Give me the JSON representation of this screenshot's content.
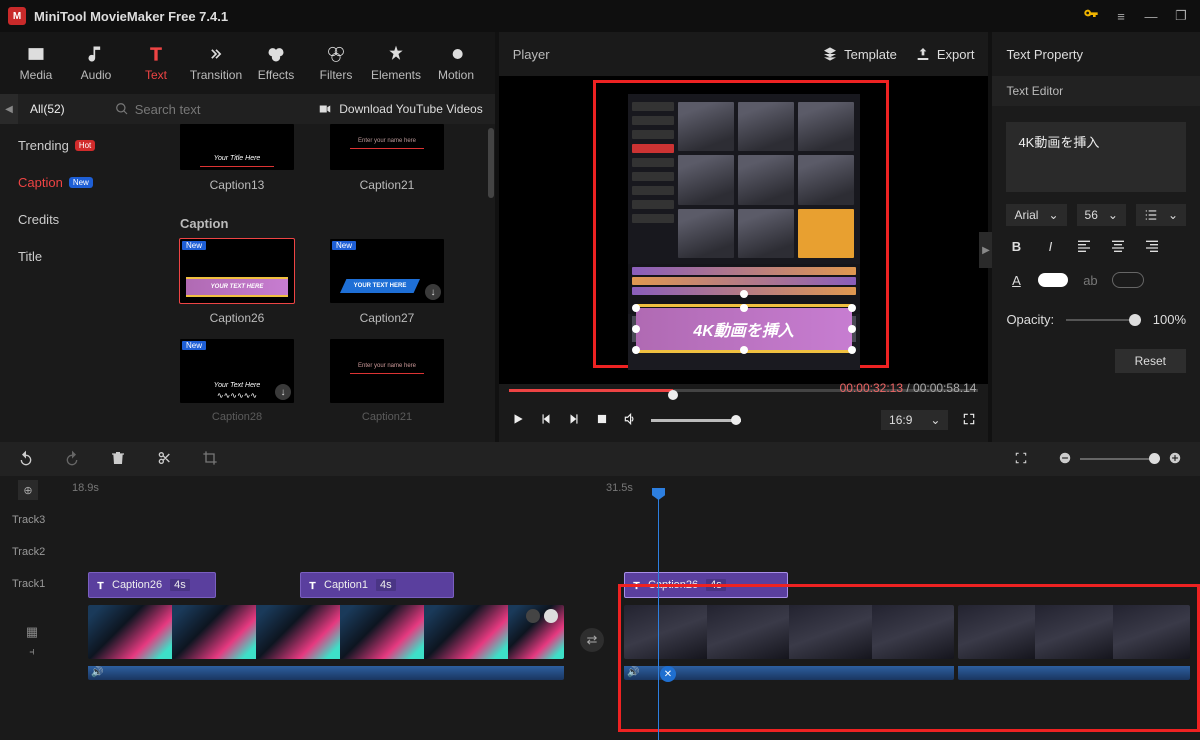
{
  "titlebar": {
    "app_name": "MiniTool MovieMaker Free 7.4.1"
  },
  "ribbon": {
    "media": "Media",
    "audio": "Audio",
    "text": "Text",
    "transition": "Transition",
    "effects": "Effects",
    "filters": "Filters",
    "elements": "Elements",
    "motion": "Motion"
  },
  "subbar": {
    "all": "All(52)",
    "search_placeholder": "Search text",
    "download": "Download YouTube Videos"
  },
  "categories": {
    "trending": "Trending",
    "trending_badge": "Hot",
    "caption": "Caption",
    "caption_badge": "New",
    "credits": "Credits",
    "title": "Title"
  },
  "captions": {
    "section": "Caption",
    "row0": [
      "Caption13",
      "Caption21"
    ],
    "row1": [
      "Caption26",
      "Caption27"
    ],
    "row2": [
      "Caption28",
      "Caption21"
    ],
    "new_tag": "New",
    "thumb_text1": "YOUR TEXT HERE",
    "thumb_text2": "YOUR TEXT HERE",
    "thumb_text_top1": "Your Title Here",
    "thumb_text_top2": "Enter your name here",
    "thumb_text3": "Your Text Here",
    "thumb_text4": "Enter your name here"
  },
  "player": {
    "label": "Player",
    "template": "Template",
    "export": "Export",
    "overlay_text": "4K動画を挿入",
    "time_current": "00:00:32:13",
    "time_duration": "00:00:58.14",
    "ratio": "16:9"
  },
  "text_property": {
    "title": "Text Property",
    "editor": "Text Editor",
    "value": "4K動画を挿入",
    "font": "Arial",
    "size": "56",
    "opacity_label": "Opacity:",
    "opacity_value": "100%",
    "reset": "Reset"
  },
  "timeline": {
    "time_a": "18.9s",
    "time_b": "31.5s",
    "tracks": [
      "Track3",
      "Track2",
      "Track1"
    ],
    "clip1": {
      "name": "Caption26",
      "dur": "4s"
    },
    "clip2": {
      "name": "Caption1",
      "dur": "4s"
    },
    "clip3": {
      "name": "Caption26",
      "dur": "4s"
    }
  }
}
